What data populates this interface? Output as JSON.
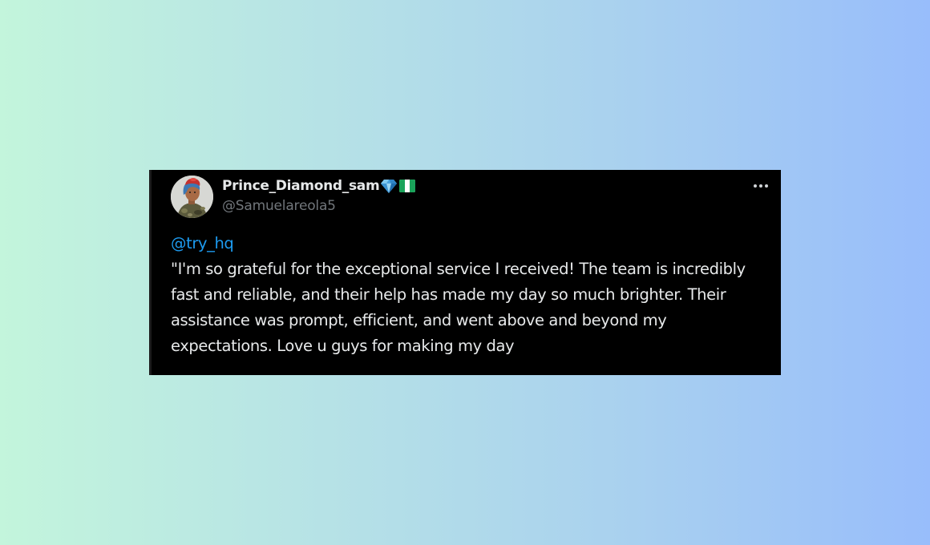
{
  "background": {
    "gradient_start": "#c3f5dc",
    "gradient_end": "#98bdfb"
  },
  "tweet": {
    "card_color": "#000000",
    "author": {
      "display_name": "Prince_Diamond_sam",
      "handle": "@Samuelareola5",
      "badges": [
        "gem-stone-emoji",
        "nigeria-flag-emoji"
      ]
    },
    "more_icon": "more-horizontal-icon",
    "mention": "@try_hq",
    "mention_color": "#1d9bf0",
    "text": "\"I'm so grateful for the exceptional service I received! The team is incredibly fast and reliable, and their help has made my day so much brighter. Their assistance was prompt, efficient, and went above and beyond my expectations. Love u guys for making my day"
  }
}
